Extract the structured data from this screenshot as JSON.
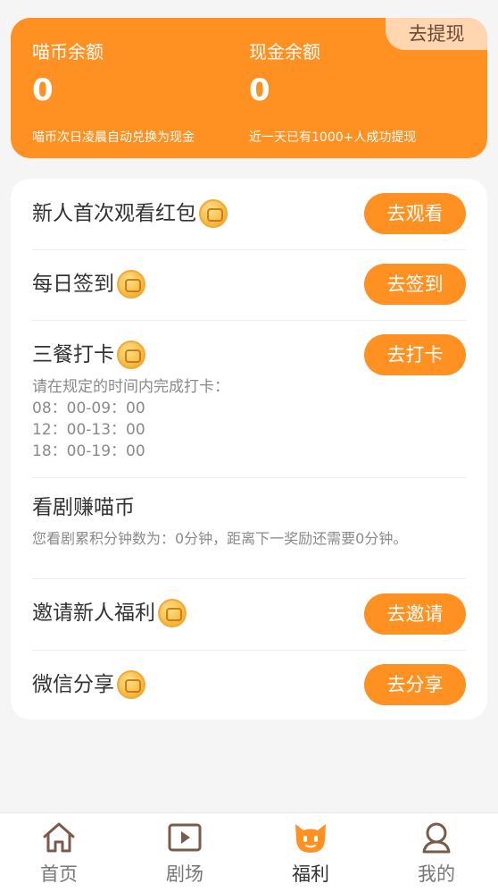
{
  "balance": {
    "withdraw_label": "去提现",
    "coin_label": "喵币余额",
    "coin_value": "0",
    "coin_note": "喵币次日凌晨自动兑换为现金",
    "cash_label": "现金余额",
    "cash_value": "0",
    "cash_note": "近一天已有1000+人成功提现"
  },
  "tasks": {
    "newbie": {
      "title": "新人首次观看红包",
      "button": "去观看"
    },
    "checkin": {
      "title": "每日签到",
      "button": "去签到"
    },
    "meals": {
      "title": "三餐打卡",
      "button": "去打卡",
      "note": "请在规定的时间内完成打卡：",
      "slots": [
        "08：00-09：00",
        "12：00-13：00",
        "18：00-19：00"
      ]
    },
    "watch": {
      "title": "看剧赚喵币",
      "note": "您看剧累积分钟数为：0分钟，距离下一奖励还需要0分钟。"
    },
    "invite": {
      "title": "邀请新人福利",
      "button": "去邀请"
    },
    "share": {
      "title": "微信分享",
      "button": "去分享"
    }
  },
  "tabs": [
    {
      "label": "首页",
      "icon": "home-icon"
    },
    {
      "label": "剧场",
      "icon": "play-icon"
    },
    {
      "label": "福利",
      "icon": "cat-icon"
    },
    {
      "label": "我的",
      "icon": "user-icon"
    }
  ],
  "colors": {
    "accent": "#ff9022",
    "withdraw_bg": "#ffd6b0"
  }
}
